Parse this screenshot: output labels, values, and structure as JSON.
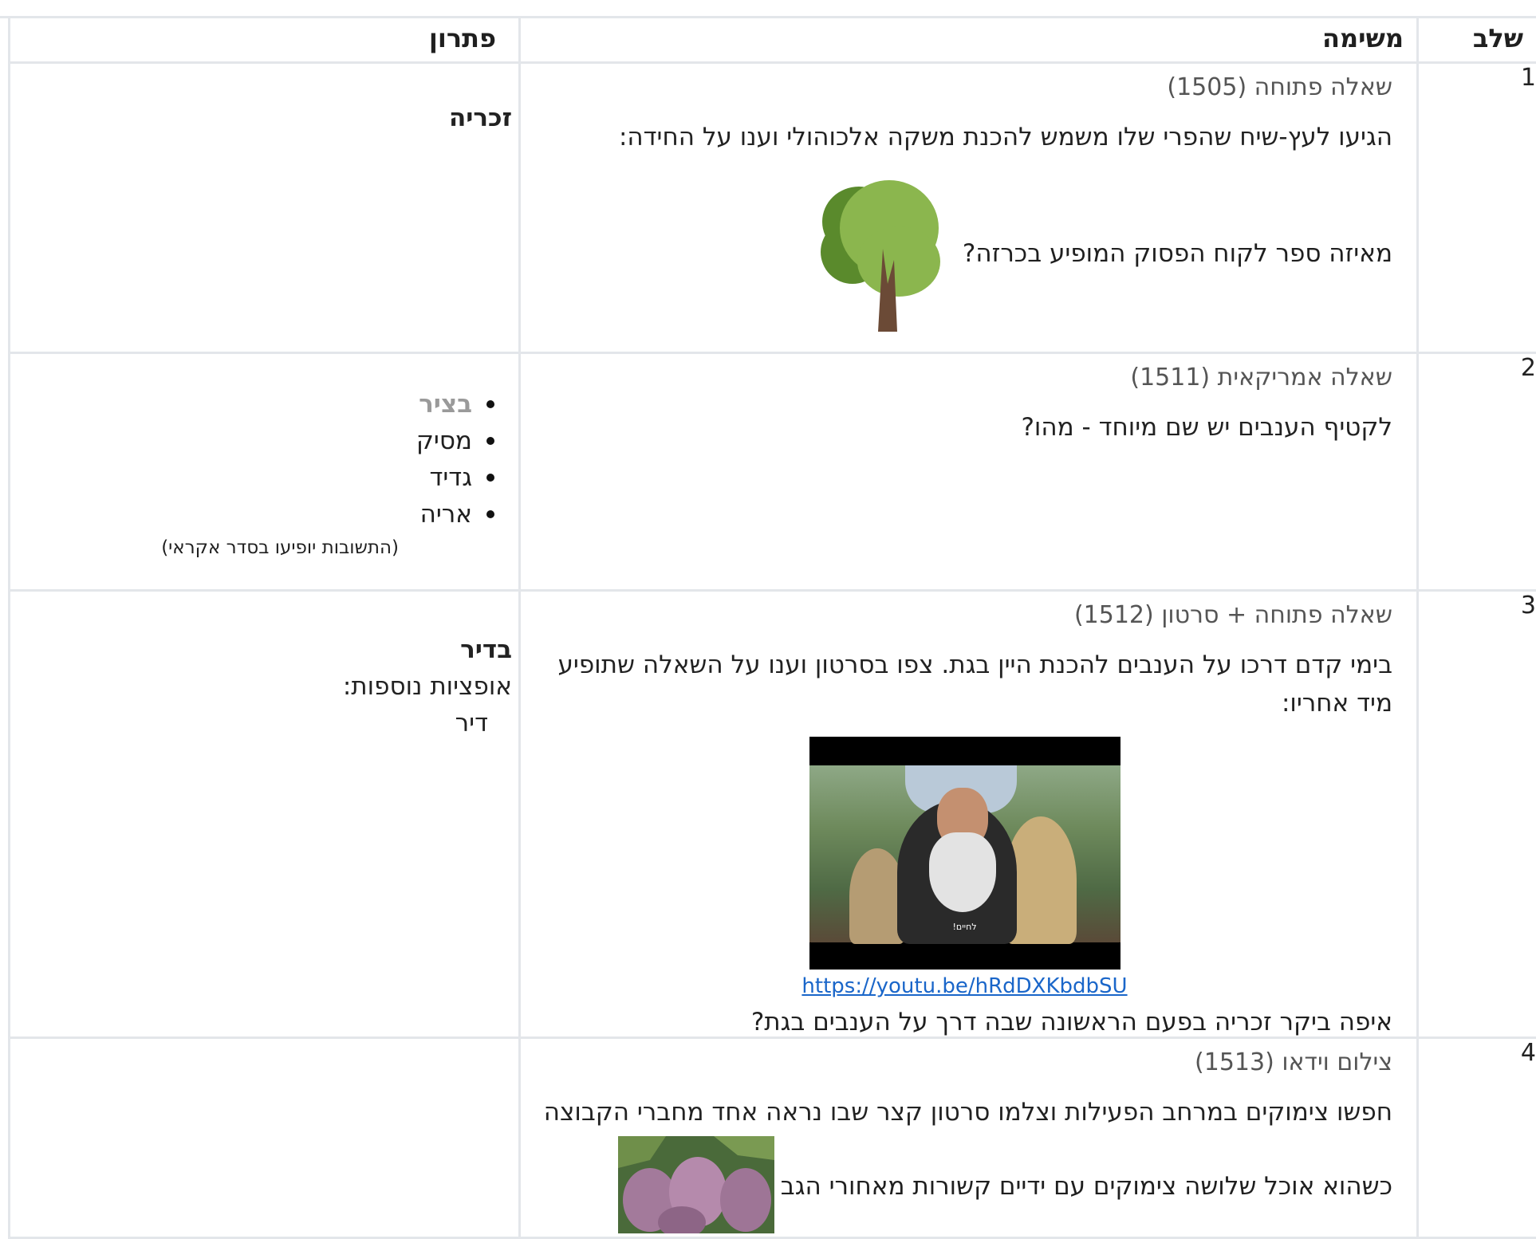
{
  "headers": {
    "step": "שלב",
    "task": "משימה",
    "solution": "פתרון"
  },
  "rows": [
    {
      "step": "1",
      "type": "שאלה פתוחה (1505)",
      "text1": "הגיעו לעץ-שיח שהפרי שלו משמש להכנת משקה אלכוהולי וענו על החידה:",
      "text2": "מאיזה ספר לקוח הפסוק המופיע בכרזה?",
      "solution": "זכריה"
    },
    {
      "step": "2",
      "type": "שאלה אמריקאית (1511)",
      "text1": "לקטיף הענבים יש שם מיוחד - מהו?",
      "choices": [
        "בציר",
        "מסיק",
        "גדיד",
        "אריה"
      ],
      "note": "(התשובות יופיעו בסדר אקראי)"
    },
    {
      "step": "3",
      "type": "שאלה פתוחה + סרטון (1512)",
      "text1": "בימי קדם דרכו על הענבים להכנת היין בגת. צפו בסרטון וענו על השאלה שתופיע מיד אחריו:",
      "video_subtitle": "לחיים!",
      "link": "https://youtu.be/hRdDXKbdbSU",
      "text2": "איפה ביקר זכריה בפעם הראשונה שבה דרך על הענבים בגת?",
      "solution_bold": "בדיר",
      "solution_label": "אופציות נוספות:",
      "solution_extra": "דיר"
    },
    {
      "step": "4",
      "type": "צילום וידאו (1513)",
      "text1": "חפשו צימוקים במרחב הפעילות וצלמו סרטון קצר שבו נראה אחד מחברי הקבוצה",
      "text2": "כשהוא אוכל שלושה צימוקים עם ידיים קשורות מאחורי הגב"
    }
  ],
  "icons": {
    "row1_image": "tree-icon",
    "row3_image": "video-thumbnail",
    "row4_image": "grapes-photo"
  }
}
